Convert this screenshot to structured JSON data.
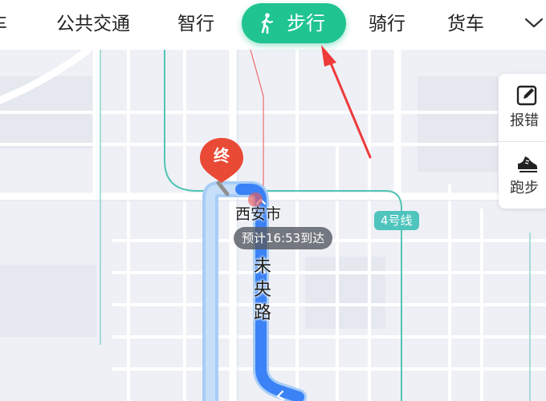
{
  "tabs": [
    {
      "label": "车",
      "active": false
    },
    {
      "label": "公共交通",
      "active": false
    },
    {
      "label": "智行",
      "active": false
    },
    {
      "label": "步行",
      "active": true
    },
    {
      "label": "骑行",
      "active": false
    },
    {
      "label": "货车",
      "active": false
    }
  ],
  "active_tab_icon": "walk-icon",
  "more_icon": "chevron-down-icon",
  "side_panel": {
    "report": {
      "label": "报错",
      "icon": "edit-icon"
    },
    "run": {
      "label": "跑步",
      "icon": "shoe-icon"
    }
  },
  "map": {
    "end_marker": "终",
    "city": "西安市",
    "eta": "预计16:53到达",
    "road": [
      "未",
      "央",
      "路"
    ],
    "metro_line": "4号线"
  },
  "colors": {
    "accent": "#20c490",
    "route": "#3b82f6",
    "marker": "#e94a35",
    "annotation_arrow": "#ee3b3b"
  }
}
